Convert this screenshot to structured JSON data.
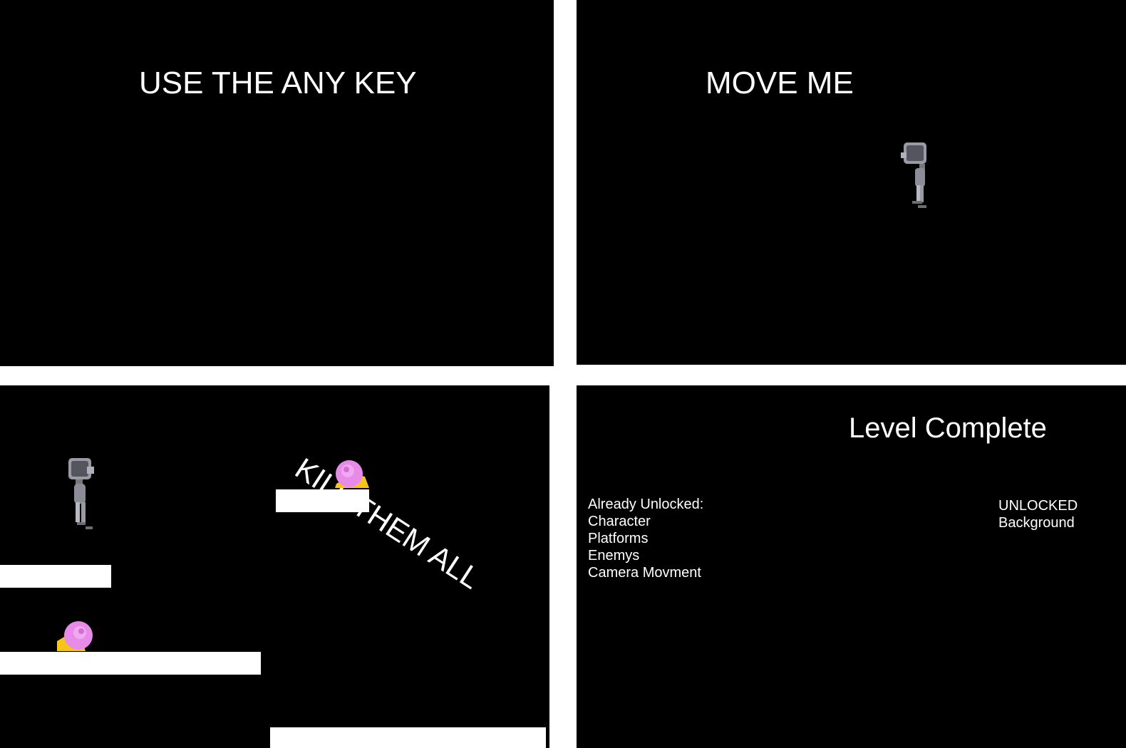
{
  "panels": {
    "p1": {
      "title": "USE THE ANY KEY"
    },
    "p2": {
      "title": "MOVE ME",
      "sprite": "robot-character"
    },
    "p3": {
      "title": "KILL THEM ALL",
      "sprites": [
        "robot-character",
        "snail-enemy",
        "snail-enemy"
      ]
    },
    "p4": {
      "title": "Level Complete",
      "unlocked_list": [
        "Already Unlocked:",
        "Character",
        "Platforms",
        "Enemys",
        "Camera Movment"
      ],
      "new_list": [
        "UNLOCKED",
        "Background"
      ]
    }
  },
  "colors": {
    "background": "#000000",
    "text": "#ffffff",
    "platform": "#ffffff",
    "snail_shell": "#e88ae8",
    "snail_body": "#f5c518",
    "robot_metal": "#8c8c96"
  }
}
